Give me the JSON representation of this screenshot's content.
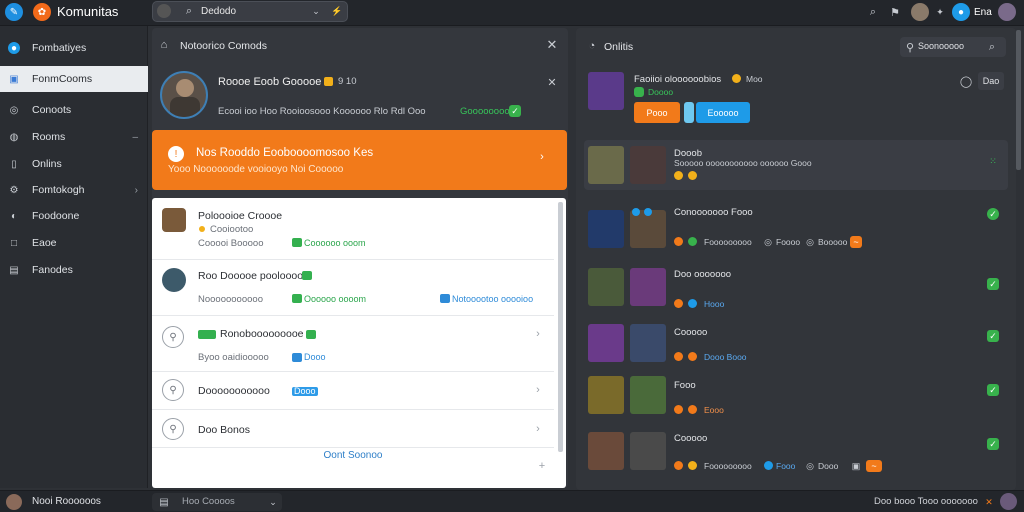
{
  "app": {
    "title": "Komunitas",
    "accent": "#f27a1a",
    "blue": "#1e9be8"
  },
  "topbar": {
    "search_value": "Dedodo",
    "icons": [
      "wrench-icon",
      "logo-icon",
      "search-icon",
      "chevron-down-icon",
      "close-icon",
      "bolt-icon",
      "search-icon",
      "chat-icon",
      "user-name"
    ],
    "user_label": "Ena"
  },
  "sidebar": {
    "items": [
      {
        "label": "Fombatiyes",
        "icon": "people-icon"
      },
      {
        "label": "FonmCooms",
        "icon": "card-icon"
      },
      {
        "label": "Conoots",
        "icon": "globe-icon"
      },
      {
        "label": "Rooms",
        "icon": "chat-icon"
      },
      {
        "label": "Onlins",
        "icon": "phone-icon"
      },
      {
        "label": "Fomtokogh",
        "icon": "gear-icon"
      },
      {
        "label": "Foodoone",
        "icon": "users-icon"
      },
      {
        "label": "Eaoe",
        "icon": "square-icon"
      },
      {
        "label": "Fanodes",
        "icon": "image-icon"
      }
    ]
  },
  "left_panel": {
    "title": "Notoorico Comods",
    "profile": {
      "name": "Roooe Eoob Gooooe",
      "badge": "9 10",
      "desc": "Ecooi ioo Hoo Rooioosooo Koooooo Rlo Rdl Ooo",
      "tag": "Goooooooo"
    },
    "banner": {
      "title": "Nos Rooddo Eooboooomosoo Kes",
      "subtitle": "Yooo Noooooode vooiooyo Noi Cooooo"
    },
    "rows": [
      {
        "title": "Poloooioe Croooe",
        "sub1": "Cooiootoo",
        "sub2": "Cooooi Booooo",
        "tag": "Coooooo ooom"
      },
      {
        "title": "Roo Dooooe pooloooo",
        "sub2": "Nooooooooooo",
        "tag": "Oooooo oooom",
        "tag2": "Notooootoo ooooioo"
      },
      {
        "title": "Ronobooooooooe",
        "sub2": "Byoo oaidiooooo",
        "tag": "Dooo"
      },
      {
        "title": "Dooooooooooo",
        "tag": "Dooo"
      },
      {
        "title": "Doo Bonos"
      }
    ],
    "footer": "Oont Soonoo"
  },
  "right_panel": {
    "title": "Onlitis",
    "search_label": "Soonooooo",
    "items": [
      {
        "title": "Faoiioi oloooooobios",
        "badge": "Moo",
        "tag": "Doooo",
        "btn1": "Pooo",
        "btn2": "Eooooo",
        "side": "Dao"
      },
      {
        "title": "Dooob",
        "line": "Sooooo ooooooooooo oooooo Gooo",
        "tags": [
          "B",
          "B"
        ]
      },
      {
        "title": "Conooooooo Fooo",
        "tags": [
          "Fooooooooo",
          "Foooo",
          "Booooo"
        ]
      },
      {
        "title": "Doo ooooooo",
        "tags": [
          "Hooo"
        ]
      },
      {
        "title": "Cooooo",
        "tags": [
          "Dooo Booo"
        ]
      },
      {
        "title": "Fooo",
        "tags": [
          "Eooo"
        ]
      },
      {
        "title": "Cooooo",
        "tags": [
          "Fooooooooo",
          "Fooo",
          "Dooo"
        ]
      }
    ]
  },
  "bottombar": {
    "user": "Nooi Roooooos",
    "input": "Hoo Coooos",
    "status": "Doo booo Tooo ooooooo"
  }
}
